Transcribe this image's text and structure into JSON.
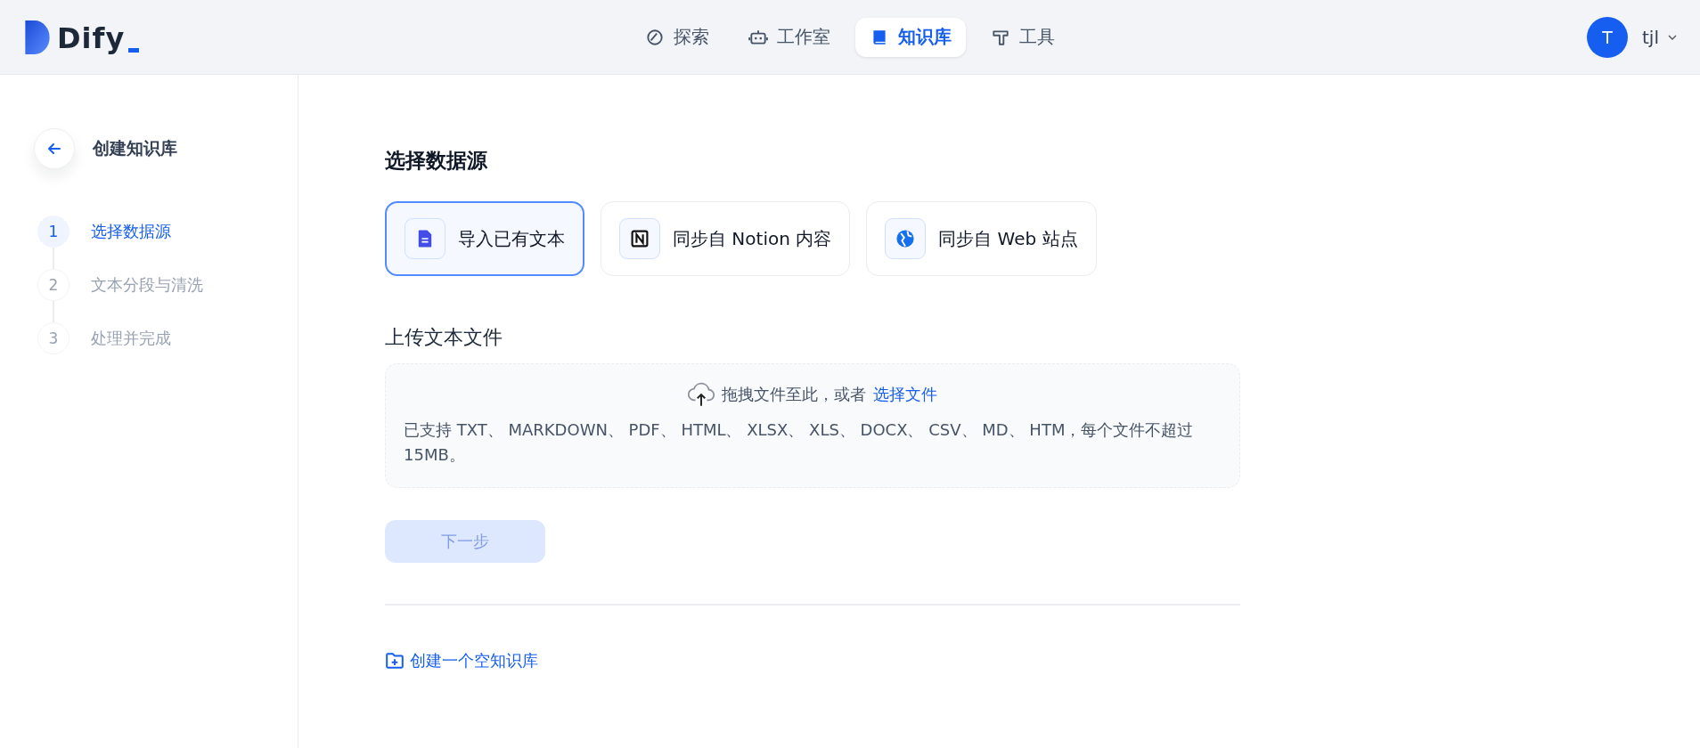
{
  "header": {
    "logo": "Dify",
    "nav": [
      {
        "label": "探索",
        "kind": "explore",
        "selected": false
      },
      {
        "label": "工作室",
        "kind": "studio",
        "selected": false
      },
      {
        "label": "知识库",
        "kind": "knowledge",
        "selected": true
      },
      {
        "label": "工具",
        "kind": "tools",
        "selected": false
      }
    ],
    "user": {
      "initial": "T",
      "name": "tjl"
    }
  },
  "sidebar": {
    "title": "创建知识库",
    "steps": [
      {
        "number": "1",
        "label": "选择数据源",
        "selected": true
      },
      {
        "number": "2",
        "label": "文本分段与清洗",
        "selected": false
      },
      {
        "number": "3",
        "label": "处理并完成",
        "selected": false
      }
    ]
  },
  "main": {
    "title": "选择数据源",
    "sources": [
      {
        "label": "导入已有文本",
        "kind": "file",
        "selected": true
      },
      {
        "label": "同步自 Notion 内容",
        "kind": "notion",
        "selected": false
      },
      {
        "label": "同步自 Web 站点",
        "kind": "web",
        "selected": false
      }
    ],
    "upload": {
      "title": "上传文本文件",
      "prompt": "拖拽文件至此，或者",
      "link": "选择文件",
      "hint": "已支持 TXT、 MARKDOWN、 PDF、 HTML、 XLSX、 XLS、 DOCX、 CSV、 MD、 HTM，每个文件不超过 15MB。"
    },
    "next_button": {
      "label": "下一步",
      "disabled": true
    },
    "create_empty": "创建一个空知识库"
  }
}
